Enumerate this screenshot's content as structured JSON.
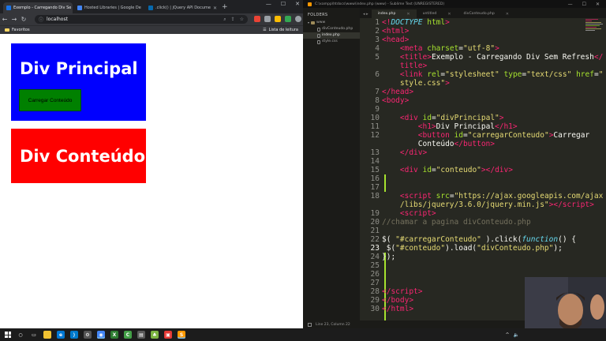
{
  "browser": {
    "tabs": [
      {
        "label": "Exemplo - Carregando Div Se",
        "active": true
      },
      {
        "label": "Hosted Libraries | Google De",
        "active": false
      },
      {
        "label": ".click() | jQuery API Docume",
        "active": false
      }
    ],
    "url": "localhost",
    "bookmarks": {
      "favorites": "Favoritos",
      "reading_list": "Lista de leitura"
    }
  },
  "page": {
    "div_principal_heading": "Div Principal",
    "button_label": "Carregar Conteúdo",
    "div_conteudo_heading": "Div Conteúdo",
    "colors": {
      "principal": "#0000ff",
      "button": "#008000",
      "conteudo": "#ff0000"
    }
  },
  "sublime": {
    "title": "C:\\xampp\\htdocs\\www\\index.php (www) - Sublime Text (UNREGISTERED)",
    "sidebar": {
      "heading": "FOLDERS",
      "items": [
        {
          "label": "www",
          "type": "folder"
        },
        {
          "label": "divConteudo.php",
          "type": "file"
        },
        {
          "label": "index.php",
          "type": "file",
          "selected": true
        },
        {
          "label": "style.css",
          "type": "file"
        }
      ]
    },
    "tabs": [
      {
        "label": "index.php",
        "active": true
      },
      {
        "label": "untitled",
        "active": false
      },
      {
        "label": "divConteudo.php",
        "active": false
      }
    ],
    "status": "Line 23, Column 22",
    "line_numbers": [
      "1",
      "2",
      "3",
      "4",
      "5",
      "",
      "6",
      "",
      "7",
      "8",
      "9",
      "10",
      "11",
      "12",
      "",
      "13",
      "14",
      "15",
      "16",
      "17",
      "18",
      "",
      "19",
      "20",
      "21",
      "22",
      "23",
      "24",
      "25",
      "26",
      "27",
      "28",
      "29",
      "30"
    ]
  },
  "icons": [
    "back-icon",
    "forward-icon",
    "reload-icon",
    "info-icon",
    "close-icon",
    "windows-start-icon",
    "search-icon"
  ]
}
